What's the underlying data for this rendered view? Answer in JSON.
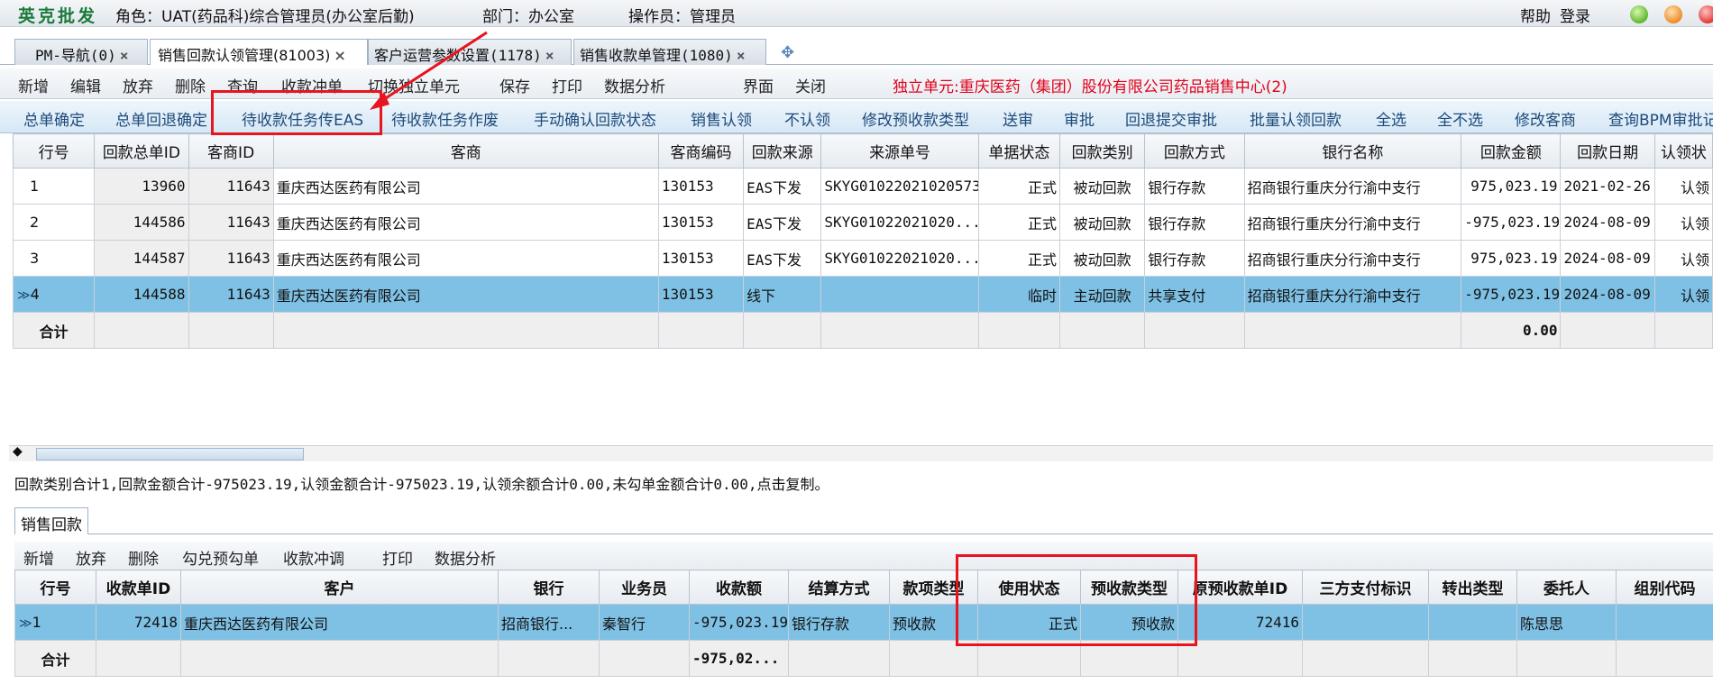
{
  "titlebar": {
    "app_name": "英克批发",
    "role": "角色：UAT(药品科)综合管理员(办公室后勤)",
    "dept": "部门：办公室",
    "operator": "操作员：管理员",
    "help": "帮助",
    "login": "登录"
  },
  "tabs": [
    {
      "label": "PM-导航(0)"
    },
    {
      "label": "销售回款认领管理(81003)"
    },
    {
      "label": "客户运营参数设置(1178)"
    },
    {
      "label": "销售收款单管理(1080)"
    }
  ],
  "toolbar1": {
    "items": [
      "新增",
      "编辑",
      "放弃",
      "删除",
      "查询",
      "收款冲单",
      "切换独立单元",
      "保存",
      "打印",
      "数据分析",
      "界面",
      "关闭"
    ],
    "alert": "独立单元:重庆医药（集团）股份有限公司药品销售中心(2)"
  },
  "toolbar2": {
    "items": [
      "总单确定",
      "总单回退确定",
      "待收款任务传EAS",
      "待收款任务作废",
      "手动确认回款状态",
      "销售认领",
      "不认领",
      "修改预收款类型",
      "送审",
      "审批",
      "回退提交审批",
      "批量认领回款",
      "全选",
      "全不选",
      "修改客商",
      "查询BPM审批记"
    ]
  },
  "grid1": {
    "headers": [
      "行号",
      "回款总单ID",
      "客商ID",
      "客商",
      "客商编码",
      "回款来源",
      "来源单号",
      "单据状态",
      "回款类别",
      "回款方式",
      "银行名称",
      "回款金额",
      "回款日期",
      "认领状"
    ],
    "rows": [
      [
        "1",
        "13960",
        "11643",
        "重庆西达医药有限公司",
        "130153",
        "EAS下发",
        "SKYG01022021020573",
        "正式",
        "被动回款",
        "银行存款",
        "招商银行重庆分行渝中支行",
        "975,023.19",
        "2021-02-26",
        "认领"
      ],
      [
        "2",
        "144586",
        "11643",
        "重庆西达医药有限公司",
        "130153",
        "EAS下发",
        "SKYG01022021020...",
        "正式",
        "被动回款",
        "银行存款",
        "招商银行重庆分行渝中支行",
        "-975,023.19",
        "2024-08-09",
        "认领"
      ],
      [
        "3",
        "144587",
        "11643",
        "重庆西达医药有限公司",
        "130153",
        "EAS下发",
        "SKYG01022021020...",
        "正式",
        "被动回款",
        "银行存款",
        "招商银行重庆分行渝中支行",
        "975,023.19",
        "2024-08-09",
        "认领"
      ],
      [
        "4",
        "144588",
        "11643",
        "重庆西达医药有限公司",
        "130153",
        "线下",
        "",
        "临时",
        "主动回款",
        "共享支付",
        "招商银行重庆分行渝中支行",
        "-975,023.19",
        "2024-08-09",
        "认领"
      ]
    ],
    "sum_label": "合计",
    "sum_amount": "0.00"
  },
  "summary_line": "回款类别合计1,回款金额合计-975023.19,认领金额合计-975023.19,认领余额合计0.00,未勾单金额合计0.00,点击复制。",
  "subtab": "销售回款",
  "toolbar3": {
    "items": [
      "新增",
      "放弃",
      "删除",
      "勾兑预勾单",
      "收款冲调",
      "打印",
      "数据分析"
    ]
  },
  "grid2": {
    "headers": [
      "行号",
      "收款单ID",
      "客户",
      "银行",
      "业务员",
      "收款额",
      "结算方式",
      "款项类型",
      "使用状态",
      "预收款类型",
      "原预收款单ID",
      "三方支付标识",
      "转出类型",
      "委托人",
      "组别代码"
    ],
    "row": [
      "1",
      "72418",
      "重庆西达医药有限公司",
      "招商银行...",
      "秦智行",
      "-975,023.19",
      "银行存款",
      "预收款",
      "正式",
      "预收款",
      "72416",
      "",
      "",
      "陈思思",
      ""
    ],
    "sum_label": "合计",
    "sum_amount": "-975,02..."
  }
}
